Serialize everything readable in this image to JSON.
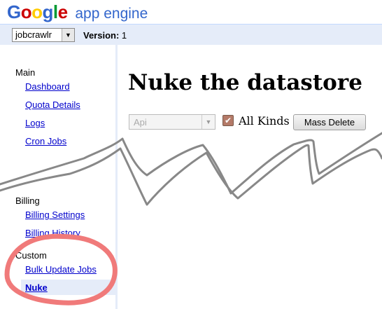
{
  "header": {
    "logo_google": "Google",
    "logo_product": "app engine",
    "google_colors": [
      "#3366cc",
      "#cc0000",
      "#ffcc00",
      "#3366cc",
      "#009933",
      "#cc0000"
    ]
  },
  "appbar": {
    "app_selected": "jobcrawlr",
    "version_label": "Version:",
    "version_value": "1"
  },
  "sidebar": {
    "sections": [
      {
        "title": "Main",
        "items": [
          "Dashboard",
          "Quota Details",
          "Logs",
          "Cron Jobs"
        ]
      },
      {
        "title": "Billing",
        "items": [
          "Billing Settings",
          "Billing History"
        ]
      },
      {
        "title": "Custom",
        "items": [
          "Bulk Update Jobs",
          "Nuke"
        ]
      }
    ],
    "active_item": "Nuke"
  },
  "main": {
    "title": "Nuke the datastore",
    "kind_select": {
      "value": "Api",
      "disabled": true
    },
    "all_kinds": {
      "label": "All Kinds",
      "checked": true
    },
    "mass_delete_label": "Mass Delete"
  },
  "annotations": {
    "scribble_color": "#888888",
    "circle_color": "#f07a7a"
  }
}
